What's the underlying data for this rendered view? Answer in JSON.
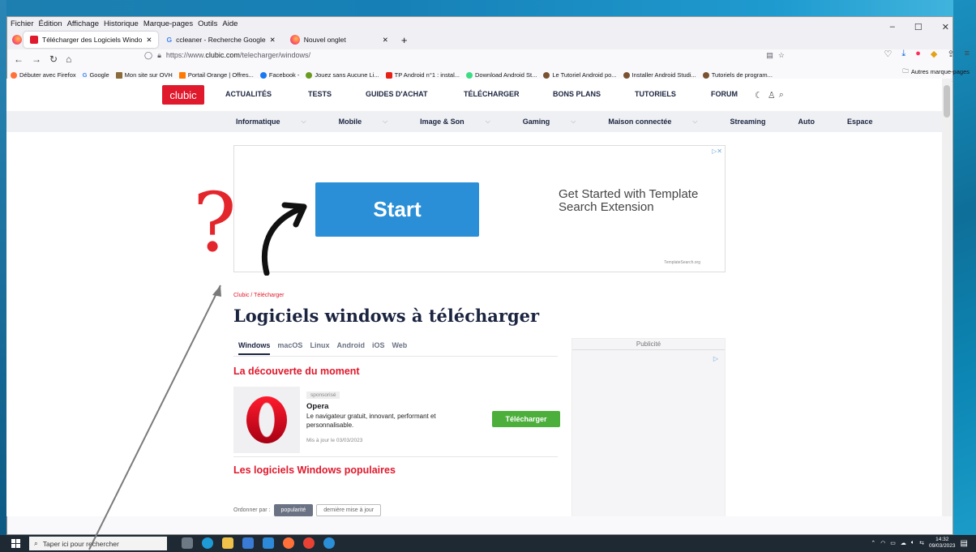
{
  "menubar": {
    "items": [
      "Fichier",
      "Édition",
      "Affichage",
      "Historique",
      "Marque-pages",
      "Outils",
      "Aide"
    ]
  },
  "tabs": [
    {
      "label": "Télécharger des Logiciels Windo",
      "active": true,
      "fav_color": "#e0192c"
    },
    {
      "label": "ccleaner - Recherche Google",
      "active": false,
      "fav_color": "#4285f4"
    },
    {
      "label": "Nouvel onglet",
      "active": false,
      "fav_color": "#ff7139"
    }
  ],
  "url": {
    "prefix": "https://www.",
    "domain": "clubic.com",
    "path": "/telecharger/windows/"
  },
  "bookmarks": [
    "Débuter avec Firefox",
    "Google",
    "Mon site sur OVH",
    "Portail Orange | Offres...",
    "Facebook -",
    "Jouez sans Aucune Li...",
    "TP Android n°1 : instal...",
    "Download Android St...",
    "Le Tutoriel Android po...",
    "Installer Android Studi...",
    "Tutoriels de program..."
  ],
  "bookmarks_other": "Autres marque-pages",
  "site": {
    "logo": "clubic",
    "nav": [
      "ACTUALITÉS",
      "TESTS",
      "GUIDES D'ACHAT",
      "TÉLÉCHARGER",
      "BONS PLANS",
      "TUTORIELS",
      "FORUM"
    ],
    "subnav": [
      "Informatique",
      "Mobile",
      "Image & Son",
      "Gaming",
      "Maison connectée",
      "Streaming",
      "Auto",
      "Espace"
    ]
  },
  "ad": {
    "button": "Start",
    "text": "Get Started with Template Search Extension",
    "source": "TemplateSearch.org"
  },
  "breadcrumb": "Clubic / Télécharger",
  "title": "Logiciels windows à télécharger",
  "os_tabs": [
    "Windows",
    "macOS",
    "Linux",
    "Android",
    "iOS",
    "Web"
  ],
  "pub_label": "Publicité",
  "discovery": {
    "heading": "La découverte du moment",
    "sponsored": "sponsorisé",
    "name": "Opera",
    "desc": "Le navigateur gratuit, innovant, performant et personnalisable.",
    "date": "Mis à jour le 03/03/2023",
    "button": "Télécharger"
  },
  "popular": {
    "heading": "Les logiciels Windows populaires",
    "sort_label": "Ordonner par :",
    "sort_options": [
      "popularité",
      "dernière mise à jour"
    ]
  },
  "taskbar": {
    "search_placeholder": "Taper ici pour rechercher",
    "time": "14:32",
    "date": "09/03/2023"
  },
  "annotation": {
    "symbol": "?",
    "color": "#e3262c"
  }
}
